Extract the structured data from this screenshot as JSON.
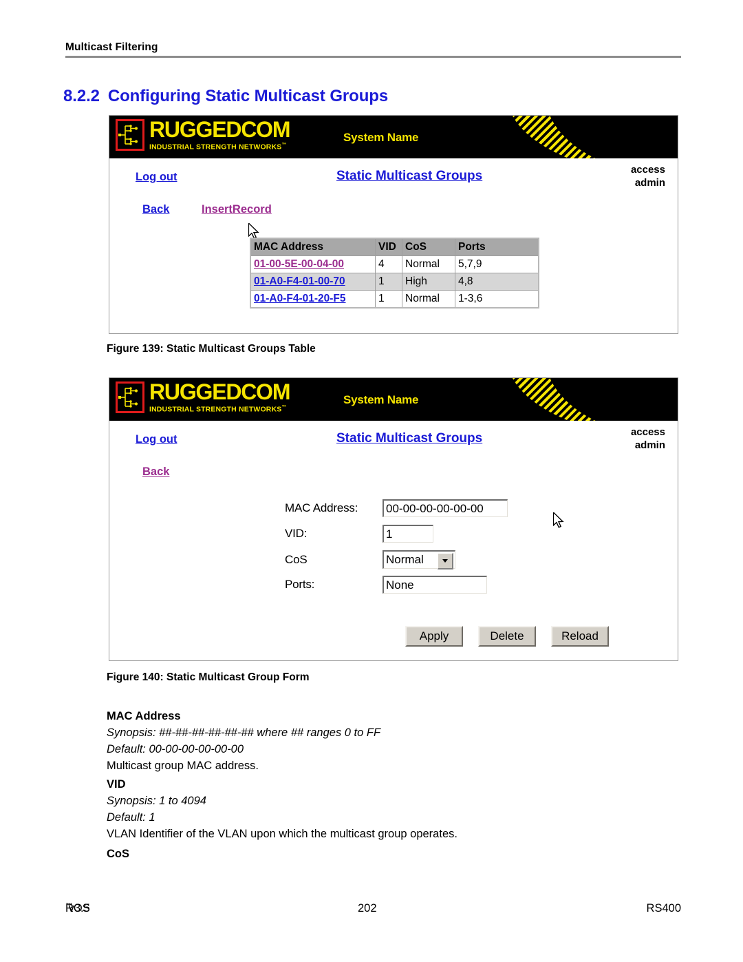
{
  "running_head": "Multicast Filtering",
  "section": {
    "number": "8.2.2",
    "title": "Configuring Static Multicast Groups"
  },
  "colors": {
    "heading_blue": "#1b1bd6",
    "link_blue": "#1b1bd6",
    "link_visited": "#9b2d8f",
    "logo_yellow": "#f5e400",
    "logo_red": "#e01b1b",
    "banner_black": "#000000",
    "table_header_gray": "#a8a8a8",
    "table_alt_row_gray": "#d6d6d6",
    "button_face": "#d4d0c8",
    "rule_gray": "#8d8d8d"
  },
  "screenshot_table": {
    "banner": {
      "logo_word": "RUGGEDCOM",
      "logo_tagline": "INDUSTRIAL STRENGTH NETWORKS",
      "logo_tagline_tm": "™",
      "system_name": "System Name"
    },
    "logout_label": "Log out",
    "page_title": "Static Multicast Groups",
    "access_label": "access",
    "access_value": "admin",
    "nav": {
      "back_label": "Back",
      "insert_label": "InsertRecord"
    },
    "table": {
      "columns": [
        "MAC Address",
        "VID",
        "CoS",
        "Ports"
      ],
      "rows": [
        {
          "mac": "01-00-5E-00-04-00",
          "vid": "4",
          "cos": "Normal",
          "ports": "5,7,9",
          "mac_link_color": "#9b2d8f"
        },
        {
          "mac": "01-A0-F4-01-00-70",
          "vid": "1",
          "cos": "High",
          "ports": "4,8",
          "mac_link_color": "#1b1bd6"
        },
        {
          "mac": "01-A0-F4-01-20-F5",
          "vid": "1",
          "cos": "Normal",
          "ports": "1-3,6",
          "mac_link_color": "#1b1bd6"
        }
      ]
    }
  },
  "caption_139": "Figure 139: Static Multicast Groups Table",
  "screenshot_form": {
    "banner": {
      "logo_word": "RUGGEDCOM",
      "logo_tagline": "INDUSTRIAL STRENGTH NETWORKS",
      "logo_tagline_tm": "™",
      "system_name": "System Name"
    },
    "logout_label": "Log out",
    "page_title": "Static Multicast Groups",
    "access_label": "access",
    "access_value": "admin",
    "nav": {
      "back_label": "Back"
    },
    "fields": {
      "mac_label": "MAC Address:",
      "mac_value": "00-00-00-00-00-00",
      "vid_label": "VID:",
      "vid_value": "1",
      "cos_label": "CoS",
      "cos_value": "Normal",
      "ports_label": "Ports:",
      "ports_value": "None"
    },
    "buttons": {
      "apply": "Apply",
      "delete": "Delete",
      "reload": "Reload"
    }
  },
  "caption_140": "Figure 140: Static Multicast Group Form",
  "parameters": [
    {
      "name": "MAC Address",
      "synopsis": "Synopsis: ##-##-##-##-##-##  where ## ranges 0 to FF",
      "default": "Default: 00-00-00-00-00-00",
      "description": "Multicast group MAC address."
    },
    {
      "name": "VID",
      "synopsis": "Synopsis: 1 to 4094",
      "default": "Default: 1",
      "description": "VLAN Identifier of the VLAN upon which the multicast group operates."
    },
    {
      "name": "CoS",
      "synopsis": "",
      "default": "",
      "description": ""
    }
  ],
  "footer": {
    "product": "ROS",
    "product_tm": "™",
    "version": "v3.5",
    "page_number": "202",
    "model": "RS400"
  }
}
